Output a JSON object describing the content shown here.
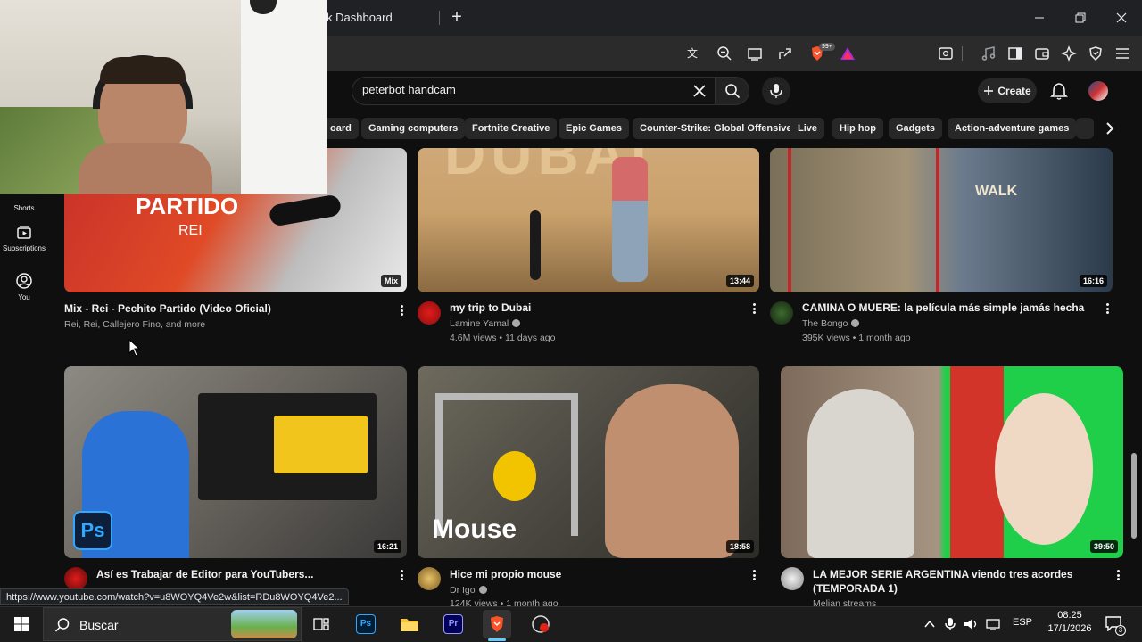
{
  "browser": {
    "tab_title": "k Dashboard",
    "new_tab": "+",
    "shields_badge": "99+",
    "status_url": "https://www.youtube.com/watch?v=u8WOYQ4Ve2w&list=RDu8WOYQ4Ve2..."
  },
  "youtube": {
    "search_value": "peterbot handcam",
    "create_label": "Create",
    "chips": [
      "oard",
      "Gaming computers",
      "Fortnite Creative",
      "Epic Games",
      "Counter-Strike: Global Offensive",
      "Live",
      "Hip hop",
      "Gadgets",
      "Action-adventure games"
    ],
    "sidebar": [
      {
        "label": "Shorts",
        "icon": "shorts-icon"
      },
      {
        "label": "Subscriptions",
        "icon": "subscriptions-icon"
      },
      {
        "label": "You",
        "icon": "you-icon"
      }
    ],
    "videos": [
      {
        "title": "Mix - Rei - Pechito Partido (Video Oficial)",
        "channel": "Rei, Rei, Callejero Fino, and more",
        "stats": "",
        "duration": "Mix",
        "thumb_text": "PARTIDO\nREI",
        "thumb_color": "#d8402a",
        "accent": "#ff5a1f"
      },
      {
        "title": "my trip to Dubai",
        "channel": "Lamine Yamal",
        "verified": true,
        "stats": "4.6M views • 11 days ago",
        "duration": "13:44",
        "thumb_color": "#c29a6a",
        "accent": "#e8c79a"
      },
      {
        "title": "CAMINA O MUERE: la película más simple jamás hecha",
        "channel": "The Bongo",
        "verified": true,
        "stats": "395K views • 1 month ago",
        "duration": "16:16",
        "thumb_color": "#7b6a4e",
        "accent": "#b5a58c"
      },
      {
        "title": "Así es Trabajar de Editor para YouTubers...",
        "channel": "",
        "stats": "",
        "duration": "16:21",
        "thumb_text": "Ps",
        "thumb_color": "#6b6f74",
        "accent": "#2f6fd6"
      },
      {
        "title": "Hice mi propio mouse",
        "channel": "Dr Igo",
        "verified": true,
        "stats": "124K views • 1 month ago",
        "duration": "18:58",
        "thumb_text": "Mouse",
        "thumb_color": "#5a5a52",
        "accent": "#f2c400"
      },
      {
        "title": "LA MEJOR SERIE ARGENTINA viendo tres acordes (TEMPORADA 1)",
        "channel": "Melian streams",
        "stats": "",
        "duration": "39:50",
        "thumb_color": "#1fcf4a",
        "accent": "#e8553b"
      }
    ]
  },
  "taskbar": {
    "search_label": "Buscar",
    "language": "ESP",
    "time": "08:25",
    "date": "17/1/2026",
    "notifications": "3"
  }
}
